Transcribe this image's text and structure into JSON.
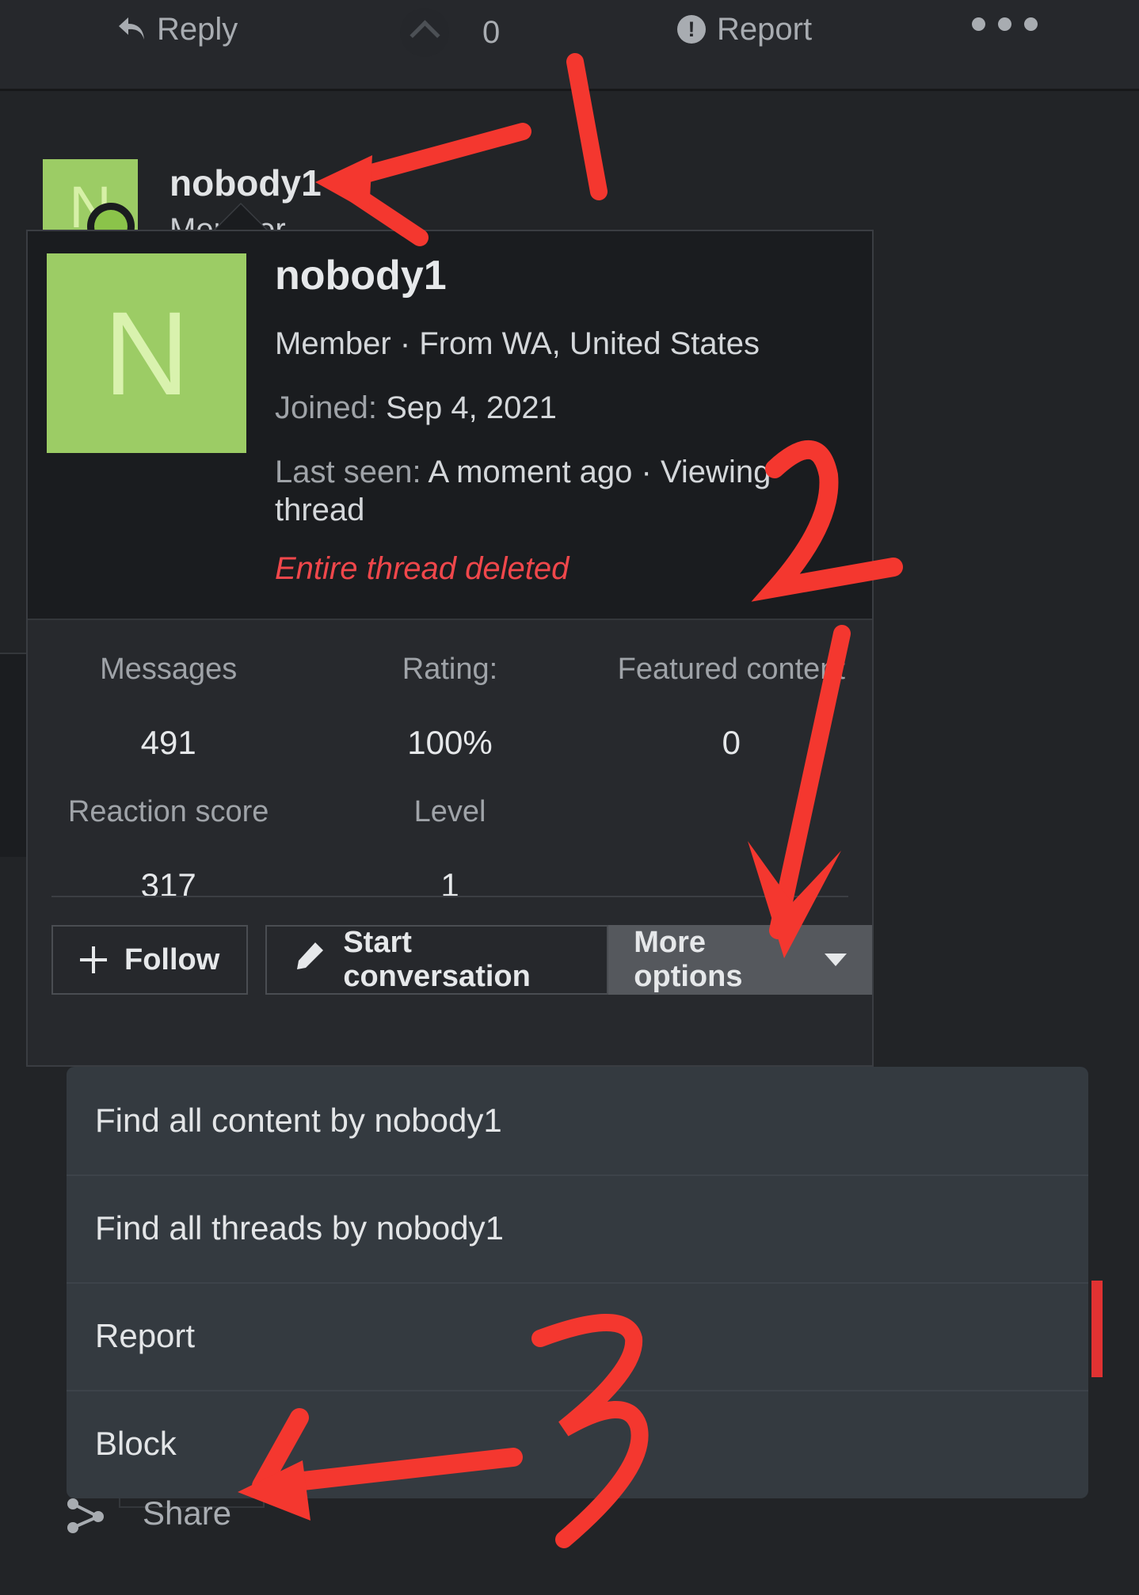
{
  "toolbar": {
    "reply_label": "Reply",
    "reply_icon": "reply-arrow-icon",
    "vote_count": "0",
    "vote_icon": "chevron-up-icon",
    "report_label": "Report",
    "report_icon": "warning-circle-icon",
    "more_icon": "ellipsis-icon"
  },
  "background_post": {
    "avatar_letter": "N",
    "username": "nobody1",
    "subtitle": "Member",
    "share_label": "Share",
    "share_icon": "share-nodes-icon"
  },
  "profile_card": {
    "avatar_letter": "N",
    "username": "nobody1",
    "member_line": "Member · From WA, United States",
    "joined_label": "Joined:",
    "joined_value": "Sep 4, 2021",
    "last_seen_label": "Last seen:",
    "last_seen_value": "A moment ago · Viewing thread",
    "deleted_notice": "Entire thread deleted",
    "stats": [
      {
        "key": "Messages",
        "value": "491"
      },
      {
        "key": "Rating:",
        "value": "100%"
      },
      {
        "key": "Featured content",
        "value": "0"
      },
      {
        "key": "Reaction score",
        "value": "317"
      },
      {
        "key": "Level",
        "value": "1"
      },
      {
        "key": "",
        "value": ""
      }
    ],
    "buttons": {
      "follow": "Follow",
      "follow_icon": "plus-icon",
      "start_conversation": "Start conversation",
      "start_conversation_icon": "pencil-icon",
      "more_options": "More options",
      "more_options_icon": "caret-down-icon"
    }
  },
  "dropdown_menu": {
    "items": [
      {
        "label": "Find all content by nobody1"
      },
      {
        "label": "Find all threads by nobody1"
      },
      {
        "label": "Report"
      },
      {
        "label": "Block"
      }
    ]
  },
  "annotations": {
    "markers": [
      "1",
      "2",
      "3"
    ],
    "color": "#f4372f",
    "note_1_points_to": "username-nobody1",
    "note_2_points_to": "more-options-button",
    "note_3_points_to": "menu-item-block"
  },
  "colors": {
    "page_bg": "#222427",
    "card_header_bg": "#1a1c1f",
    "card_body_bg": "#27292d",
    "menu_bg": "#343a40",
    "avatar_green": "#9ccc65",
    "accent_red": "#f0474b",
    "annotation_red": "#f4372f"
  }
}
